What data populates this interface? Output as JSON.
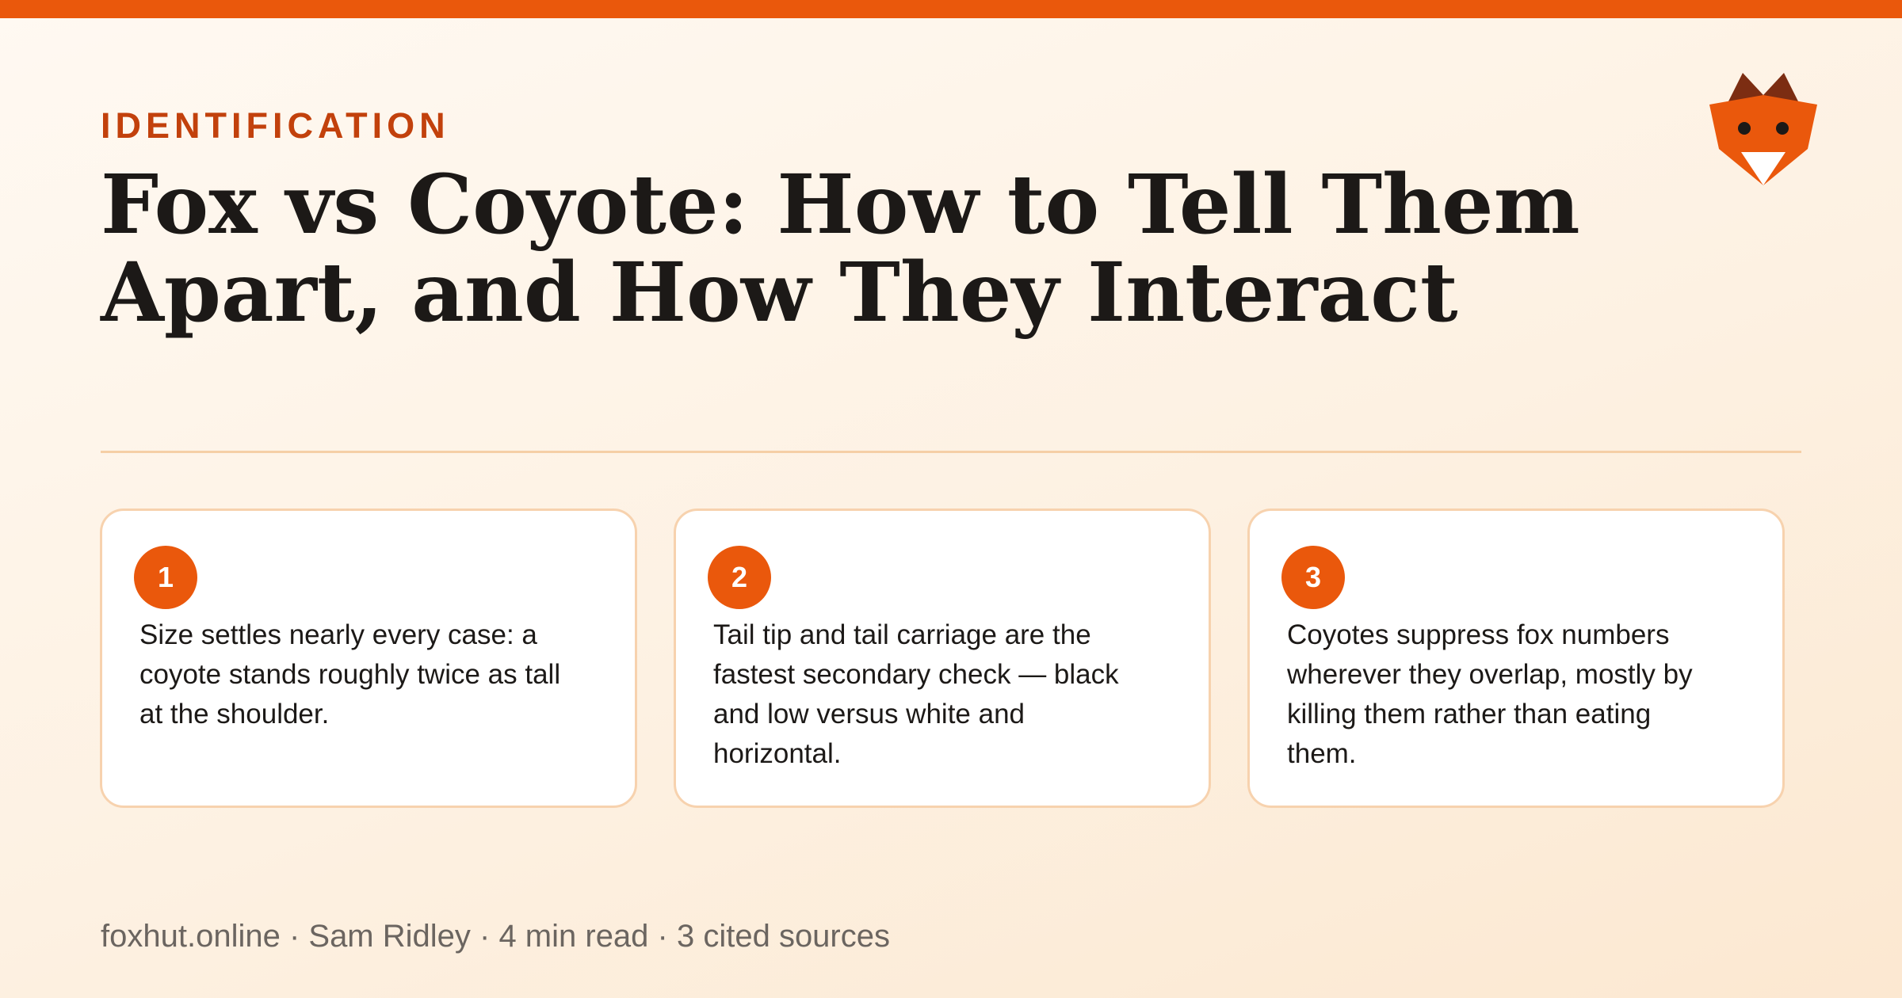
{
  "header": {
    "eyebrow": "IDENTIFICATION",
    "title": "Fox vs Coyote: How to Tell Them Apart, and How They Interact"
  },
  "logo": {
    "icon": "fox-head-icon"
  },
  "cards": [
    {
      "number": "1",
      "text": "Size settles nearly every case: a coyote stands roughly twice as tall at the shoulder."
    },
    {
      "number": "2",
      "text": "Tail tip and tail carriage are the fastest secondary check — black and low versus white and horizontal."
    },
    {
      "number": "3",
      "text": "Coyotes suppress fox numbers wherever they overlap, mostly by killing them rather than eating them."
    }
  ],
  "footer": {
    "text": "foxhut.online · Sam Ridley · 4 min read · 3 cited sources"
  },
  "colors": {
    "accent": "#ea580c",
    "eyebrow": "#c2410c",
    "title": "#1c1917",
    "card_border": "#f7d2ae",
    "footer_text": "#6b6560"
  }
}
